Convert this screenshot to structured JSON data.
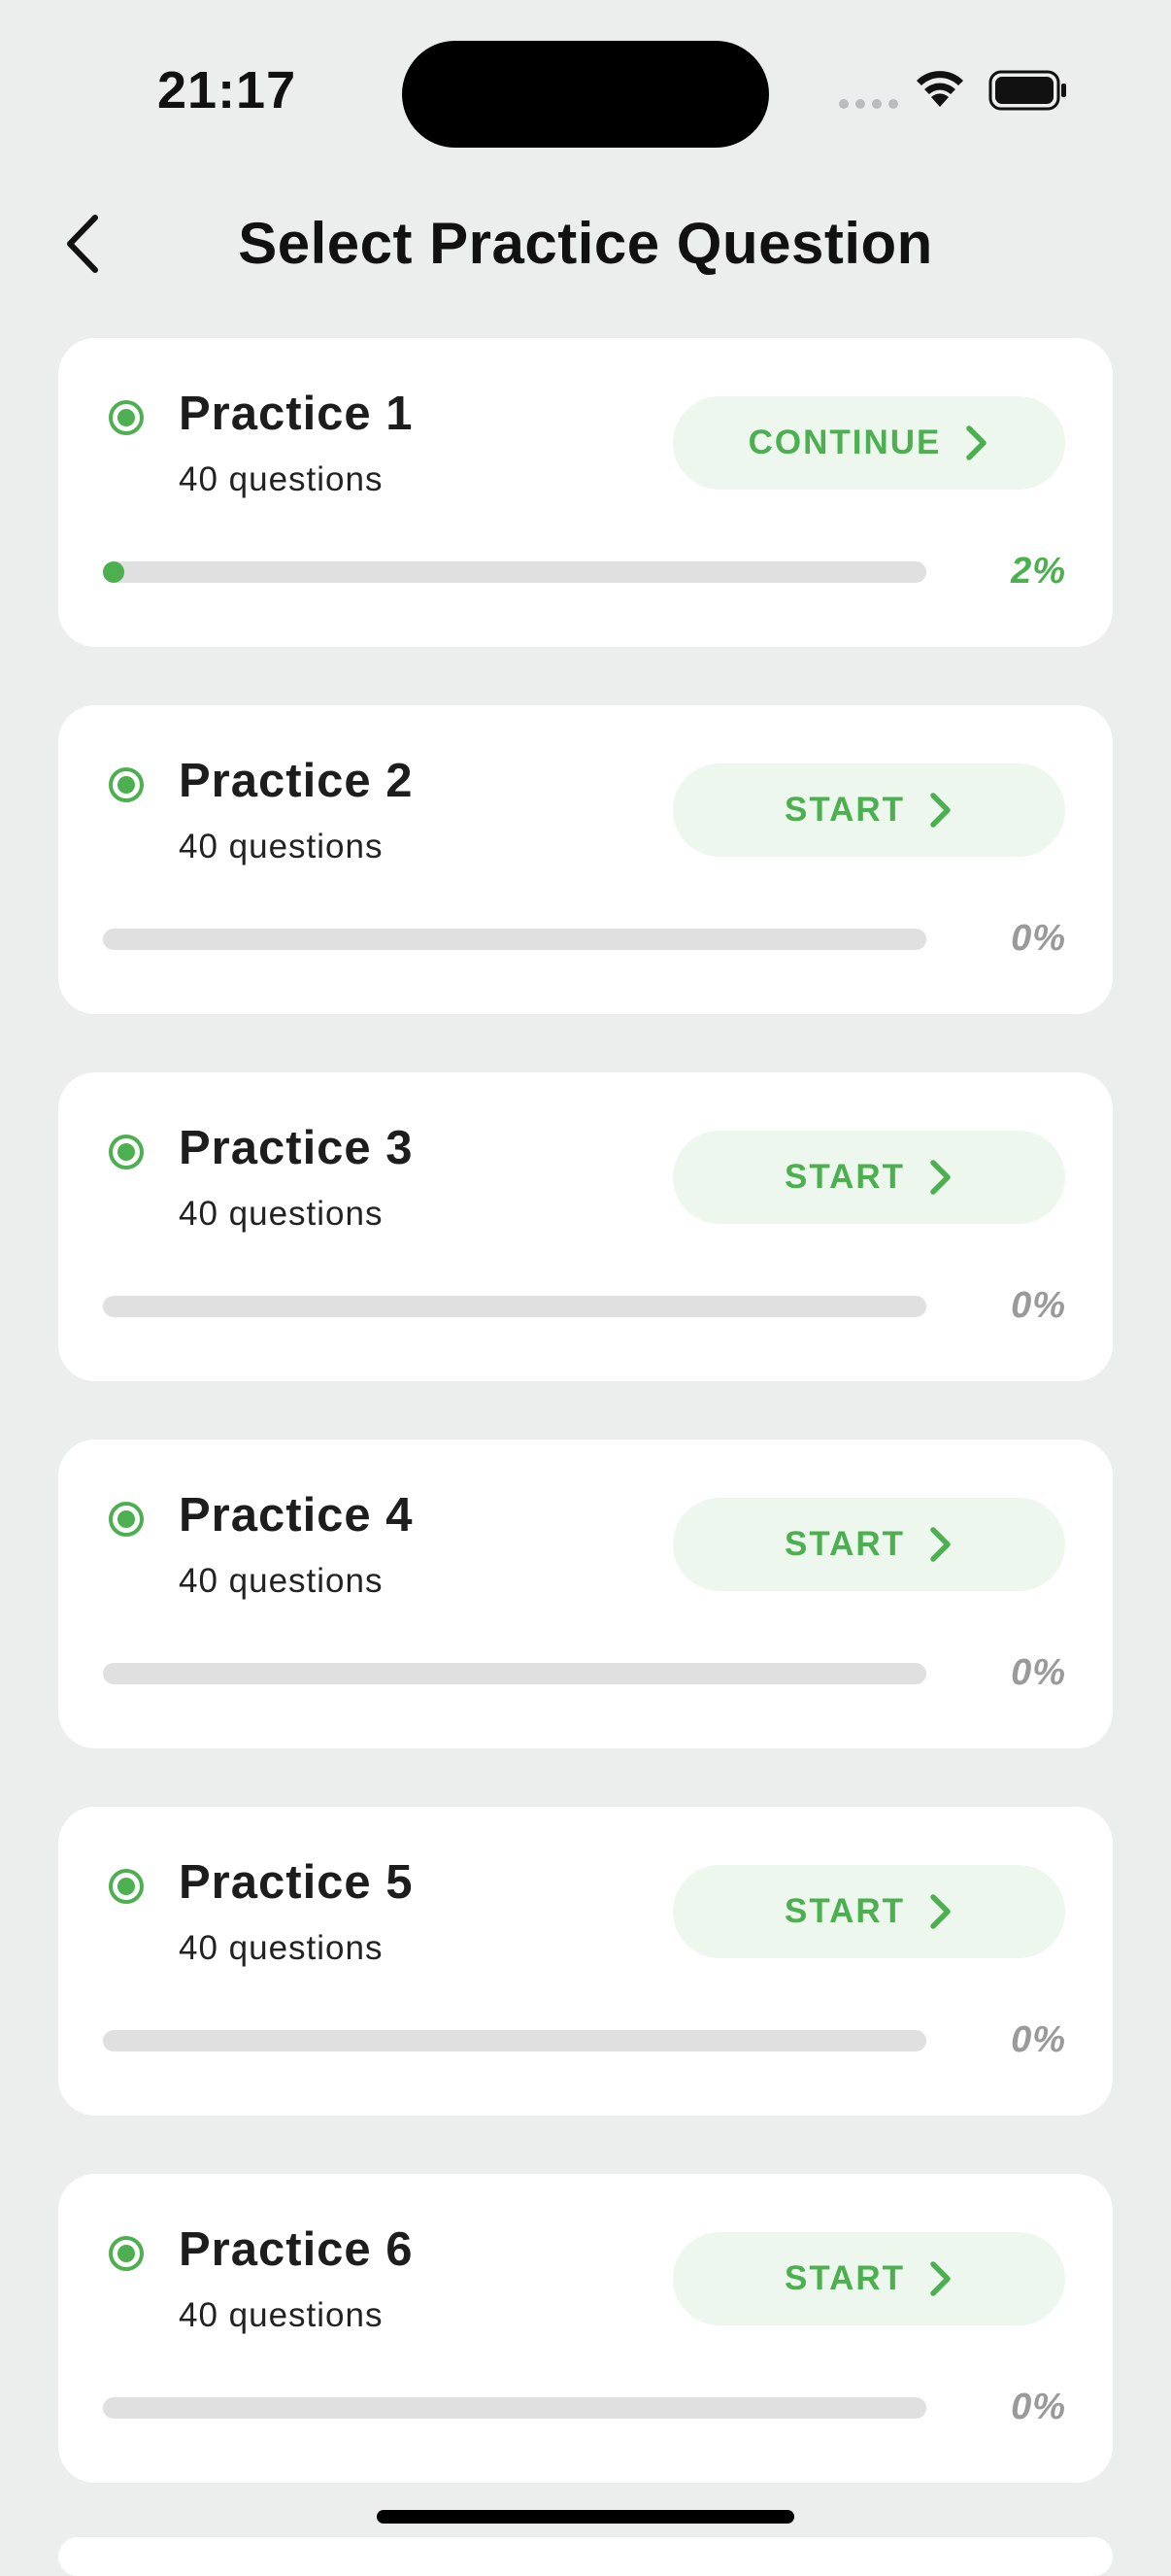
{
  "status_bar": {
    "time": "21:17",
    "icons": [
      "signal-icon",
      "wifi-icon",
      "battery-icon"
    ]
  },
  "header": {
    "title": "Select Practice Question",
    "back_icon": "chevron-left-icon"
  },
  "colors": {
    "accent": "#4caf50",
    "button_bg": "#eef7ee",
    "background": "#ebeeed",
    "card": "#ffffff",
    "track": "#e0e0e0",
    "muted": "#9a9a9a"
  },
  "practices": [
    {
      "title": "Practice 1",
      "subtitle": "40 questions",
      "action": "CONTINUE",
      "percent_label": "2%",
      "progress": 0.02
    },
    {
      "title": "Practice 2",
      "subtitle": "40 questions",
      "action": "START",
      "percent_label": "0%",
      "progress": 0
    },
    {
      "title": "Practice 3",
      "subtitle": "40 questions",
      "action": "START",
      "percent_label": "0%",
      "progress": 0
    },
    {
      "title": "Practice 4",
      "subtitle": "40 questions",
      "action": "START",
      "percent_label": "0%",
      "progress": 0
    },
    {
      "title": "Practice 5",
      "subtitle": "40 questions",
      "action": "START",
      "percent_label": "0%",
      "progress": 0
    },
    {
      "title": "Practice 6",
      "subtitle": "40 questions",
      "action": "START",
      "percent_label": "0%",
      "progress": 0
    }
  ]
}
